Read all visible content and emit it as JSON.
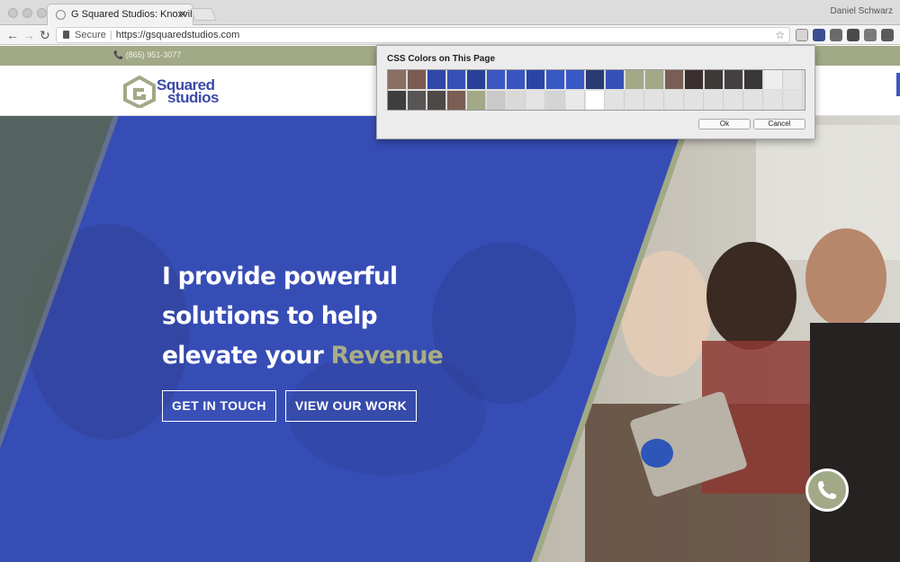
{
  "browser": {
    "tab_title": "G Squared Studios: Knoxville W",
    "tab_close": "✕",
    "profile_name": "Daniel Schwarz",
    "url_secure_label": "Secure",
    "url": "https://gsquaredstudios.com",
    "star_glyph": "☆",
    "nav": {
      "back": "←",
      "forward": "→",
      "reload": "↻"
    },
    "extension_icons": [
      {
        "name": "eyedropper-extension-icon",
        "color": "#5b5b5b"
      },
      {
        "name": "reader-extension-icon",
        "color": "#3a4d8f"
      },
      {
        "name": "circle-extension-icon",
        "color": "#6a6a6a"
      },
      {
        "name": "camera-extension-icon",
        "color": "#4a4a4a"
      },
      {
        "name": "refresh-extension-icon",
        "color": "#7a7a7a"
      },
      {
        "name": "menu-icon",
        "color": "#5a5a5a"
      }
    ]
  },
  "site": {
    "phone": "📞 (865) 951-3077",
    "logo": {
      "line1": "Squared",
      "line2": "studios"
    },
    "headline": {
      "line1": "I provide powerful",
      "line2": "solutions to help",
      "line3_prefix": "elevate your ",
      "accent": "Revenue"
    },
    "buttons": {
      "contact": "GET IN TOUCH",
      "work": "VIEW OUR WORK"
    },
    "phone_fab_glyph": "📞"
  },
  "colors": {
    "brand_blue": "#3a57c2",
    "brand_olive": "#a1a986",
    "accent_text": "#a9ad85"
  },
  "popup": {
    "title": "CSS Colors on This Page",
    "ok_label": "Ok",
    "cancel_label": "Cancel",
    "swatches_row1": [
      "#8a6e62",
      "#7b5c52",
      "#2e47a8",
      "#3750b6",
      "#284095",
      "#3a57c2",
      "#3855bf",
      "#2b45a6",
      "#3958c4",
      "#3a58c6",
      "#2a3a72",
      "#3652b8",
      "#a1a986",
      "#a1a986",
      "#7a5e54",
      "#3a3030",
      "#3f3838",
      "#444041",
      "#3a3837",
      "#eeeeee",
      "#e6e6e6"
    ],
    "swatches_row2": [
      "#3e3e3e",
      "#5a5555",
      "#4e4846",
      "#7a5e54",
      "#a1a986",
      "#c9c9c9",
      "#d9d9d9",
      "#e3e3e3",
      "#d4d4d4",
      "#e9e9e9",
      "#ffffff",
      "#e2e2e2",
      "#e2e2e2",
      "#e2e2e2",
      "#e2e2e2",
      "#e2e2e2",
      "#e2e2e2",
      "#e2e2e2",
      "#e2e2e2",
      "#e2e2e2",
      "#e2e2e2"
    ]
  }
}
